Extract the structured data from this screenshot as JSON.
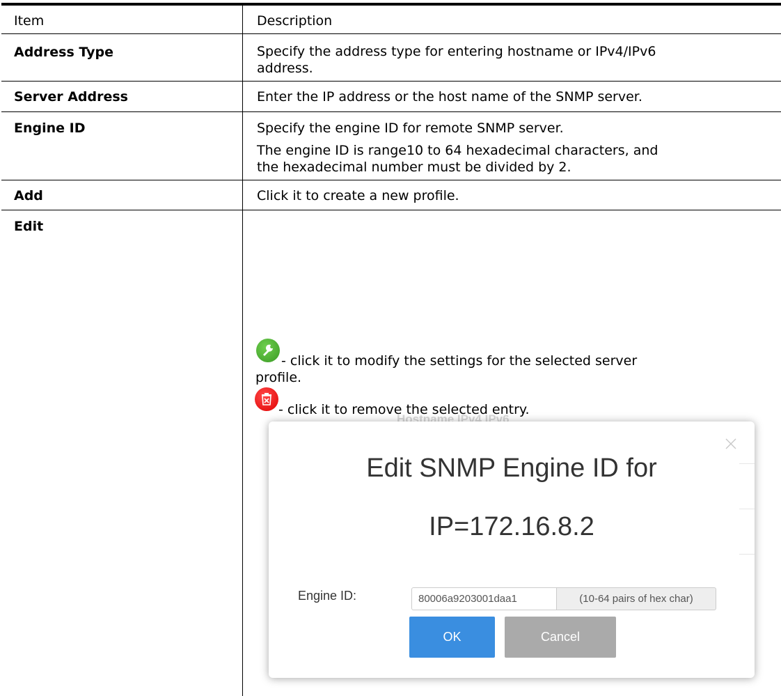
{
  "table": {
    "header": {
      "item": "Item",
      "description": "Description"
    },
    "rows": [
      {
        "item": "Address Type",
        "description": [
          "Specify the address type for entering hostname or IPv4/IPv6",
          "address."
        ]
      },
      {
        "item": "Server Address",
        "description": [
          "Enter the IP address or the host name of the SNMP server."
        ]
      },
      {
        "item": "Engine ID",
        "description": [
          "Specify the engine ID for remote SNMP server.",
          "The engine ID is range10 to 64 hexadecimal characters, and",
          "the hexadecimal number must be divided by 2."
        ]
      },
      {
        "item": "Add",
        "description": [
          "Click it to create a new profile."
        ]
      },
      {
        "item": "Edit",
        "description": [
          "- click it to modify the settings for the selected server",
          "profile.",
          "- click it to remove the selected entry."
        ]
      }
    ]
  },
  "icons": {
    "edit": "wrench-icon",
    "delete": "trash-icon",
    "edit_color": "#3f9f2a",
    "delete_color": "#ff1a1a"
  },
  "background_fragment": "Hostname    IPv4    IPv6",
  "dialog": {
    "title_line1": "Edit SNMP Engine ID for",
    "title_line2": "IP=172.16.8.2",
    "engine_label": "Engine ID:",
    "engine_value": "80006a9203001daa1",
    "engine_hint": "(10-64 pairs of hex char)",
    "ok_label": "OK",
    "cancel_label": "Cancel",
    "ok_color": "#3a8ee0",
    "cancel_color": "#aaaaaa"
  }
}
